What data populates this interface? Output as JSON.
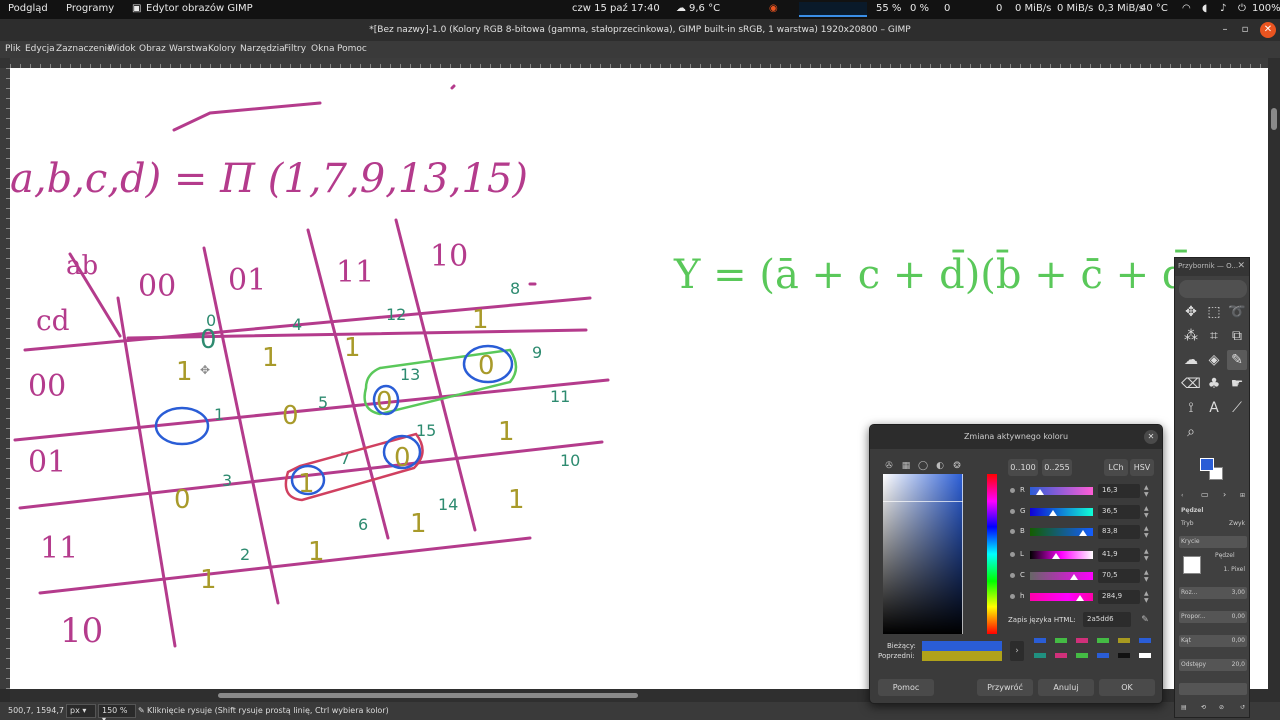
{
  "toppanel": {
    "activities": "Podgląd",
    "programs": "Programy",
    "app": "Edytor obrazów GIMP",
    "clock": "czw 15 paź  17:40",
    "weather": "9,6 °C",
    "cpu": "55 %",
    "mem": "0 %",
    "net1": "0",
    "net2": "0",
    "net3": "0 MiB/s",
    "net4": "0,3 MiB/s",
    "temp": "40 °C",
    "battery": "100%"
  },
  "window": {
    "title": "*[Bez nazwy]-1.0 (Kolory RGB 8-bitowa (gamma, stałoprzecinkowa), GIMP built-in sRGB, 1 warstwa) 1920x20800 – GIMP"
  },
  "menu": [
    "Plik",
    "Edycja",
    "Zaznaczenie",
    "Widok",
    "Obraz",
    "Warstwa",
    "Kolory",
    "Narzędzia",
    "Filtry",
    "Okna",
    "Pomoc"
  ],
  "canvas": {
    "eq_left": "a,b,c,d) = Π (1,7,9,13,15)",
    "eq_right": "Y = (ā + c + d̄)(b̄ + c̄ + d̄)(",
    "kmap_col_header": [
      "00",
      "01",
      "11",
      "10"
    ],
    "kmap_row_header": [
      "00",
      "01",
      "11",
      "10"
    ],
    "kmap_cells": [
      [
        "0",
        "1",
        "1",
        "1"
      ],
      [
        "1",
        "0",
        "0",
        "0"
      ],
      [
        "0",
        "1",
        "0",
        "1"
      ],
      [
        "1",
        "1",
        "1",
        "1"
      ]
    ],
    "kmap_index": [
      "0",
      "4",
      "12",
      "8",
      "1",
      "5",
      "13",
      "9",
      "3",
      "7",
      "15",
      "11",
      "2",
      "6",
      "14",
      "10"
    ],
    "corner_ab": "ab",
    "corner_cd": "cd"
  },
  "statusbar": {
    "coords": "500,7, 1594,7",
    "unit": "px",
    "zoom": "150 %",
    "message": "Kliknięcie rysuje (Shift rysuje prostą linię, Ctrl wybiera kolor)"
  },
  "toolbox": {
    "title": "Przybornik — O...",
    "tool_name": "Pędzel",
    "mode_label": "Tryb",
    "mode_value": "Zwyk",
    "opacity_label": "Krycie",
    "brush_label": "Pędzel",
    "brush_value": "1. Pixel",
    "size_label": "Roz...",
    "size_value": "3,00",
    "aspect_label": "Propor...",
    "aspect_value": "0,00",
    "angle_label": "Kąt",
    "angle_value": "0,00",
    "spacing_label": "Odstępy",
    "spacing_value": "20,0",
    "fg_color": "#2a5dd6"
  },
  "dialog": {
    "title": "Zmiana aktywnego koloru",
    "range1": "0..100",
    "range2": "0..255",
    "mode1": "LCh",
    "mode2": "HSV",
    "sliders": [
      {
        "label": "R",
        "value": "16,3",
        "pct": 0.163,
        "bar": "linear-gradient(to right,#2c5cd6,#ff5dd6)"
      },
      {
        "label": "G",
        "value": "36,5",
        "pct": 0.365,
        "bar": "linear-gradient(to right,#1000d6,#10ffd6)"
      },
      {
        "label": "B",
        "value": "83,8",
        "pct": 0.838,
        "bar": "linear-gradient(to right,#145d00,#145dff)"
      },
      {
        "label": "L",
        "value": "41,9",
        "pct": 0.419,
        "bar": "linear-gradient(to right,#000,#ff00ff 50%,#fff)"
      },
      {
        "label": "C",
        "value": "70,5",
        "pct": 0.705,
        "bar": "linear-gradient(to right,#666,#ff00ff)"
      },
      {
        "label": "h",
        "value": "284,9",
        "pct": 0.79,
        "bar": "linear-gradient(to right,#ff00aa,#ff00ff 60%,#ff00aa)"
      }
    ],
    "html_label": "Zapis języka HTML:",
    "html_value": "2a5dd6",
    "current_label": "Bieżący:",
    "previous_label": "Poprzedni:",
    "current_color": "#2a5dd6",
    "previous_color": "#b0a21a",
    "history": [
      "#2a5dd6",
      "#44bb44",
      "#d0307a",
      "#44bb44",
      "#a89a20",
      "#2a5dd6",
      "#209080",
      "#d0307a",
      "#44bb44",
      "#2a5dd6",
      "#111111",
      "#ffffff"
    ],
    "help": "Pomoc",
    "reset": "Przywróć",
    "cancel": "Anuluj",
    "ok": "OK"
  }
}
